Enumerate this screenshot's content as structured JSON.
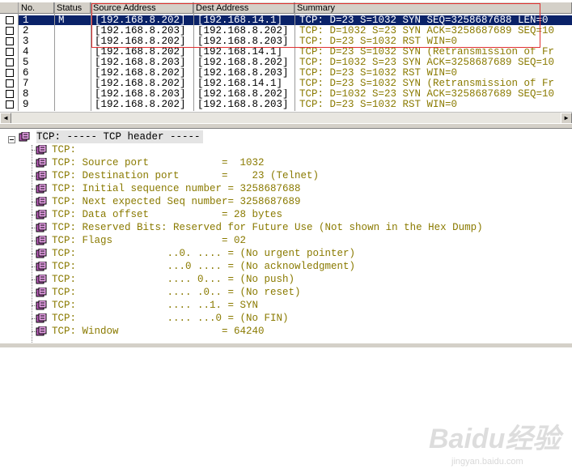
{
  "packet_list": {
    "columns": [
      "No.",
      "Status",
      "Source Address",
      "Dest Address",
      "Summary"
    ],
    "rows": [
      {
        "no": "1",
        "status": "M",
        "src": "[192.168.8.202]",
        "dst": "[192.168.14.1]",
        "summary": "TCP: D=23 S=1032 SYN SEQ=3258687688 LEN=0",
        "selected": true
      },
      {
        "no": "2",
        "status": "",
        "src": "[192.168.8.203]",
        "dst": "[192.168.8.202]",
        "summary": "TCP: D=1032 S=23 SYN ACK=3258687689 SEQ=10",
        "selected": false
      },
      {
        "no": "3",
        "status": "",
        "src": "[192.168.8.202]",
        "dst": "[192.168.8.203]",
        "summary": "TCP: D=23 S=1032 RST WIN=0",
        "selected": false
      },
      {
        "no": "4",
        "status": "",
        "src": "[192.168.8.202]",
        "dst": "[192.168.14.1]",
        "summary": "TCP: D=23 S=1032 SYN (Retransmission of Fr",
        "selected": false
      },
      {
        "no": "5",
        "status": "",
        "src": "[192.168.8.203]",
        "dst": "[192.168.8.202]",
        "summary": "TCP: D=1032 S=23 SYN ACK=3258687689 SEQ=10",
        "selected": false
      },
      {
        "no": "6",
        "status": "",
        "src": "[192.168.8.202]",
        "dst": "[192.168.8.203]",
        "summary": "TCP: D=23 S=1032 RST WIN=0",
        "selected": false
      },
      {
        "no": "7",
        "status": "",
        "src": "[192.168.8.202]",
        "dst": "[192.168.14.1]",
        "summary": "TCP: D=23 S=1032 SYN (Retransmission of Fr",
        "selected": false
      },
      {
        "no": "8",
        "status": "",
        "src": "[192.168.8.203]",
        "dst": "[192.168.8.202]",
        "summary": "TCP: D=1032 S=23 SYN ACK=3258687689 SEQ=10",
        "selected": false
      },
      {
        "no": "9",
        "status": "",
        "src": "[192.168.8.202]",
        "dst": "[192.168.8.203]",
        "summary": "TCP: D=23 S=1032 RST WIN=0",
        "selected": false
      }
    ]
  },
  "detail": {
    "header": "TCP: ----- TCP header -----",
    "lines": [
      "TCP:",
      "TCP: Source port            =  1032",
      "TCP: Destination port       =    23 (Telnet)",
      "TCP: Initial sequence number = 3258687688",
      "TCP: Next expected Seq number= 3258687689",
      "TCP: Data offset            = 28 bytes",
      "TCP: Reserved Bits: Reserved for Future Use (Not shown in the Hex Dump)",
      "TCP: Flags                  = 02",
      "TCP:               ..0. .... = (No urgent pointer)",
      "TCP:               ...0 .... = (No acknowledgment)",
      "TCP:               .... 0... = (No push)",
      "TCP:               .... .0.. = (No reset)",
      "TCP:               .... ..1. = SYN",
      "TCP:               .... ...0 = (No FIN)",
      "TCP: Window                 = 64240"
    ]
  },
  "watermark": {
    "main": "Baidu经验",
    "sub": "jingyan.baidu.com"
  },
  "colors": {
    "summary_text": "#8a7a00",
    "selection": "#0a2268",
    "highlight_box": "#e03030"
  },
  "icons": {
    "packet": "packet-icon",
    "collapse": "minus-icon"
  }
}
